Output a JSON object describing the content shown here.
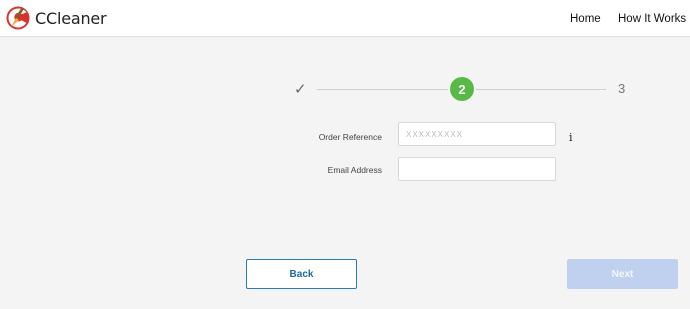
{
  "header": {
    "brand": "CCleaner",
    "nav": [
      {
        "label": "Home"
      },
      {
        "label": "How It Works"
      }
    ]
  },
  "stepper": {
    "step1_icon": "check-icon",
    "current_step": "2",
    "next_step": "3",
    "active_color": "#58b947"
  },
  "form": {
    "order_reference_label": "Order Reference",
    "order_reference_placeholder": "XXXXXXXXX",
    "order_reference_value": "",
    "email_label": "Email Address",
    "email_value": "",
    "info_glyph": "i"
  },
  "buttons": {
    "back_label": "Back",
    "next_label": "Next",
    "back_color": "#1f67a3",
    "next_disabled_color": "#bfd1ee"
  }
}
